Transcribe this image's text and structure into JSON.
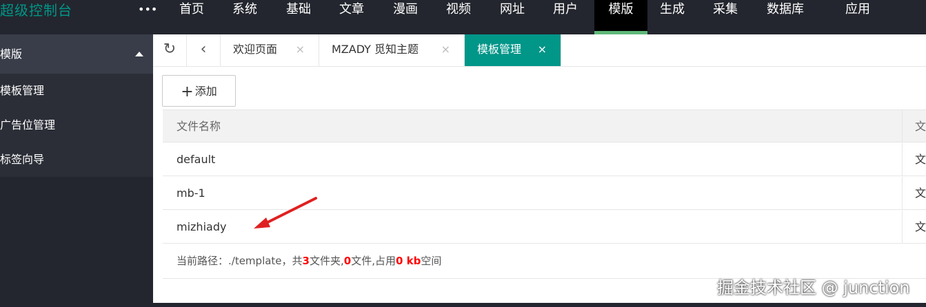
{
  "header": {
    "logo": "超级控制台",
    "more_icon": "ellipsis-icon",
    "nav": [
      "首页",
      "系统",
      "基础",
      "文章",
      "漫画",
      "视频",
      "网址",
      "用户",
      "模版",
      "生成",
      "采集",
      "数据库",
      "应用"
    ],
    "active_nav": "模版"
  },
  "sidebar": {
    "title": "模版",
    "items": [
      "模板管理",
      "广告位管理",
      "标签向导"
    ]
  },
  "tabs": {
    "refresh_icon": "refresh-icon",
    "back_icon": "chevron-left-icon",
    "items": [
      {
        "label": "欢迎页面",
        "close": "×"
      },
      {
        "label": "MZADY 觅知主题",
        "close": "×"
      },
      {
        "label": "模板管理",
        "close": "×"
      }
    ]
  },
  "toolbar": {
    "add_label": "添加",
    "add_icon": "+"
  },
  "table": {
    "headers": {
      "name": "文件名称",
      "type": "文"
    },
    "rows": [
      {
        "name": "default",
        "type": "文"
      },
      {
        "name": "mb-1",
        "type": "文"
      },
      {
        "name": "mizhiady",
        "type": "文"
      }
    ]
  },
  "footer": {
    "prefix": "当前路径：./template，共",
    "folders": "3",
    "mid1": "文件夹,",
    "files": "0",
    "mid2": "文件,占用",
    "size": "0 kb",
    "suffix": "空间"
  },
  "watermark": "掘金技术社区 @ junction",
  "colors": {
    "accent": "#009688",
    "nav_indicator": "#5fb878",
    "highlight": "#ff0000",
    "arrow": "#e02020"
  }
}
